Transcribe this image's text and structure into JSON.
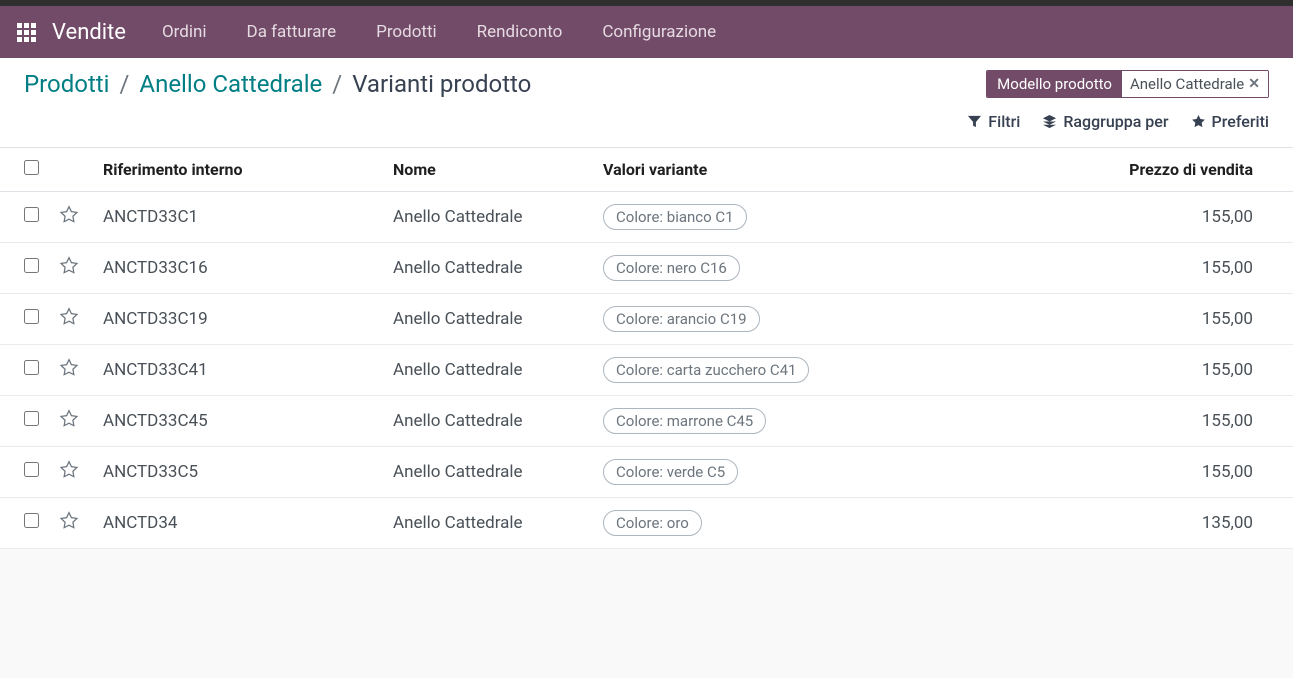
{
  "nav": {
    "app_title": "Vendite",
    "items": [
      "Ordini",
      "Da fatturare",
      "Prodotti",
      "Rendiconto",
      "Configurazione"
    ]
  },
  "breadcrumb": {
    "parts": [
      {
        "label": "Prodotti",
        "link": true
      },
      {
        "label": "Anello Cattedrale",
        "link": true
      },
      {
        "label": "Varianti prodotto",
        "link": false
      }
    ]
  },
  "search_facet": {
    "label": "Modello prodotto",
    "value": "Anello Cattedrale"
  },
  "tools": {
    "filters": "Filtri",
    "groupby": "Raggruppa per",
    "favorites": "Preferiti"
  },
  "table": {
    "headers": {
      "reference": "Riferimento interno",
      "name": "Nome",
      "variant": "Valori variante",
      "price": "Prezzo di vendita"
    },
    "rows": [
      {
        "reference": "ANCTD33C1",
        "name": "Anello Cattedrale",
        "variant": "Colore: bianco C1",
        "price": "155,00"
      },
      {
        "reference": "ANCTD33C16",
        "name": "Anello Cattedrale",
        "variant": "Colore: nero C16",
        "price": "155,00"
      },
      {
        "reference": "ANCTD33C19",
        "name": "Anello Cattedrale",
        "variant": "Colore: arancio C19",
        "price": "155,00"
      },
      {
        "reference": "ANCTD33C41",
        "name": "Anello Cattedrale",
        "variant": "Colore: carta zucchero C41",
        "price": "155,00"
      },
      {
        "reference": "ANCTD33C45",
        "name": "Anello Cattedrale",
        "variant": "Colore: marrone C45",
        "price": "155,00"
      },
      {
        "reference": "ANCTD33C5",
        "name": "Anello Cattedrale",
        "variant": "Colore: verde C5",
        "price": "155,00"
      },
      {
        "reference": "ANCTD34",
        "name": "Anello Cattedrale",
        "variant": "Colore: oro",
        "price": "135,00"
      }
    ]
  }
}
